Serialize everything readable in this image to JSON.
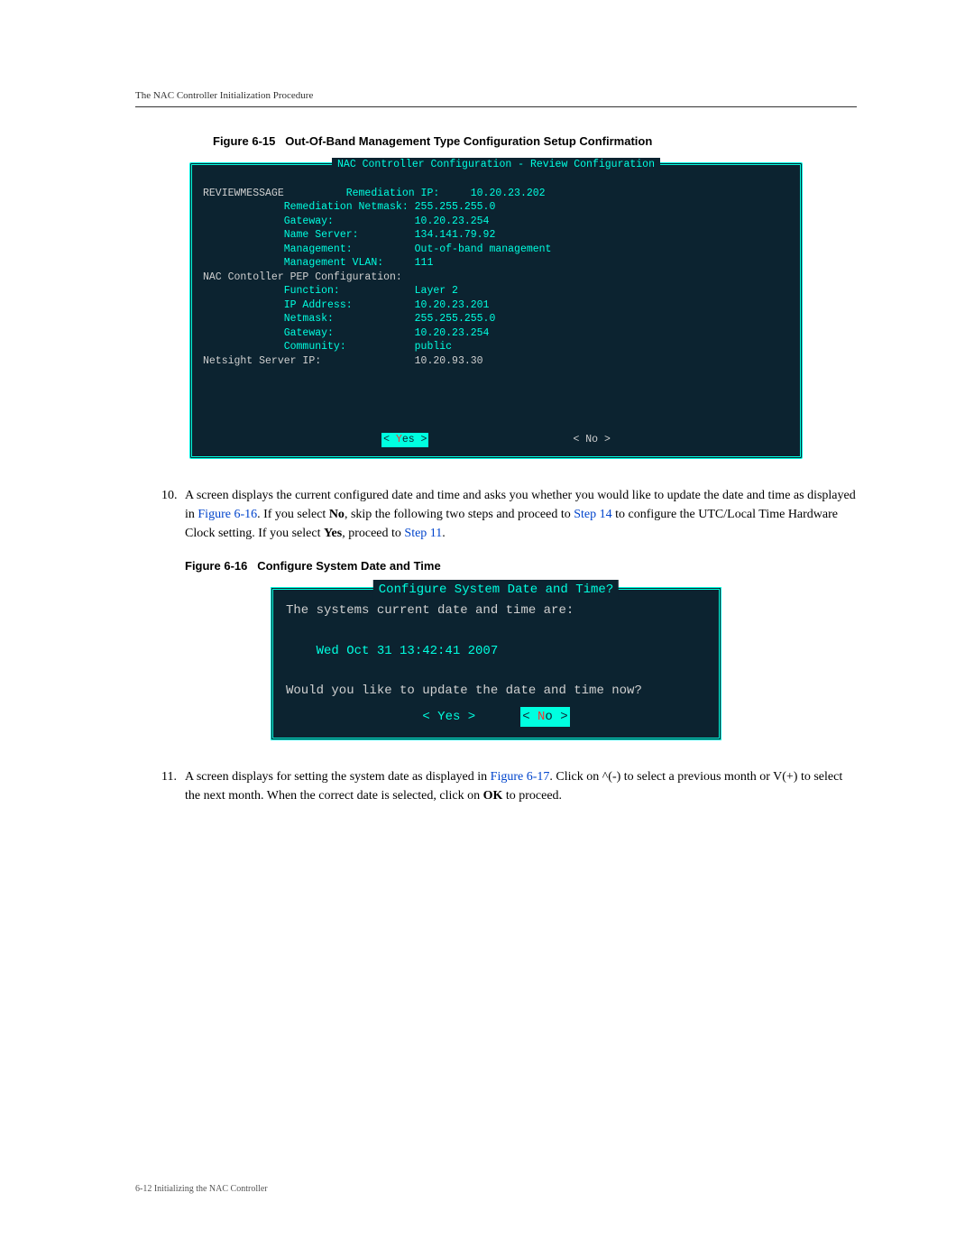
{
  "header": "The NAC Controller Initialization Procedure",
  "fig_15": {
    "label": "Figure 6-15",
    "title": "Out-Of-Band Management Type Configuration Setup Confirmation"
  },
  "terminal1": {
    "title": "NAC Controller Configuration - Review Configuration",
    "lines": {
      "l1a": "REVIEWMESSAGE",
      "l1b": "          Remediation IP:     10.20.23.202",
      "l2": "             Remediation Netmask: 255.255.255.0",
      "l3": "             Gateway:             10.20.23.254",
      "l4": "             Name Server:         134.141.79.92",
      "l5": "             Management:          Out-of-band management",
      "l6": "             Management VLAN:     111",
      "l7": "NAC Contoller PEP Configuration:",
      "l8": "             Function:            Layer 2",
      "l9": "             IP Address:          10.20.23.201",
      "l10": "             Netmask:             255.255.255.0",
      "l11": "             Gateway:             10.20.23.254",
      "l12": "             Community:           public",
      "l13": "Netsight Server IP:               10.20.93.30"
    },
    "yes_left": "< ",
    "yes_y": "Y",
    "yes_rest": "es >",
    "no": "< No  >"
  },
  "step10": {
    "num": "10.",
    "t1": "A screen displays the current configured date and time and asks you whether you would like to update the date and time as displayed in ",
    "link1": "Figure 6-16",
    "t2": ". If you select ",
    "bold1": "No",
    "t3": ", skip the following two steps and proceed to ",
    "link2": "Step 14",
    "t4": " to configure the UTC/Local Time Hardware Clock setting. If you select ",
    "bold2": "Yes",
    "t5": ", proceed to ",
    "link3": "Step 11",
    "t6": "."
  },
  "fig_16": {
    "label": "Figure 6-16",
    "title": "Configure System Date and Time"
  },
  "terminal2": {
    "title": "Configure System Date and Time?",
    "l1": "The systems current date and time are:",
    "l2": "    Wed Oct 31 13:42:41 2007",
    "l3": "Would you like to update the date and time now?",
    "yes": "< Yes >",
    "no_left": "< ",
    "no_n": "N",
    "no_rest": "o  >"
  },
  "step11": {
    "num": "11.",
    "t1": "A screen displays for setting the system date as displayed in ",
    "link1": "Figure 6-17",
    "t2": ". Click on ^(-) to select a previous month or V(+) to select the next month. When the correct date is selected, click on ",
    "bold1": "OK",
    "t3": " to proceed."
  },
  "footer": "6-12   Initializing the NAC Controller"
}
